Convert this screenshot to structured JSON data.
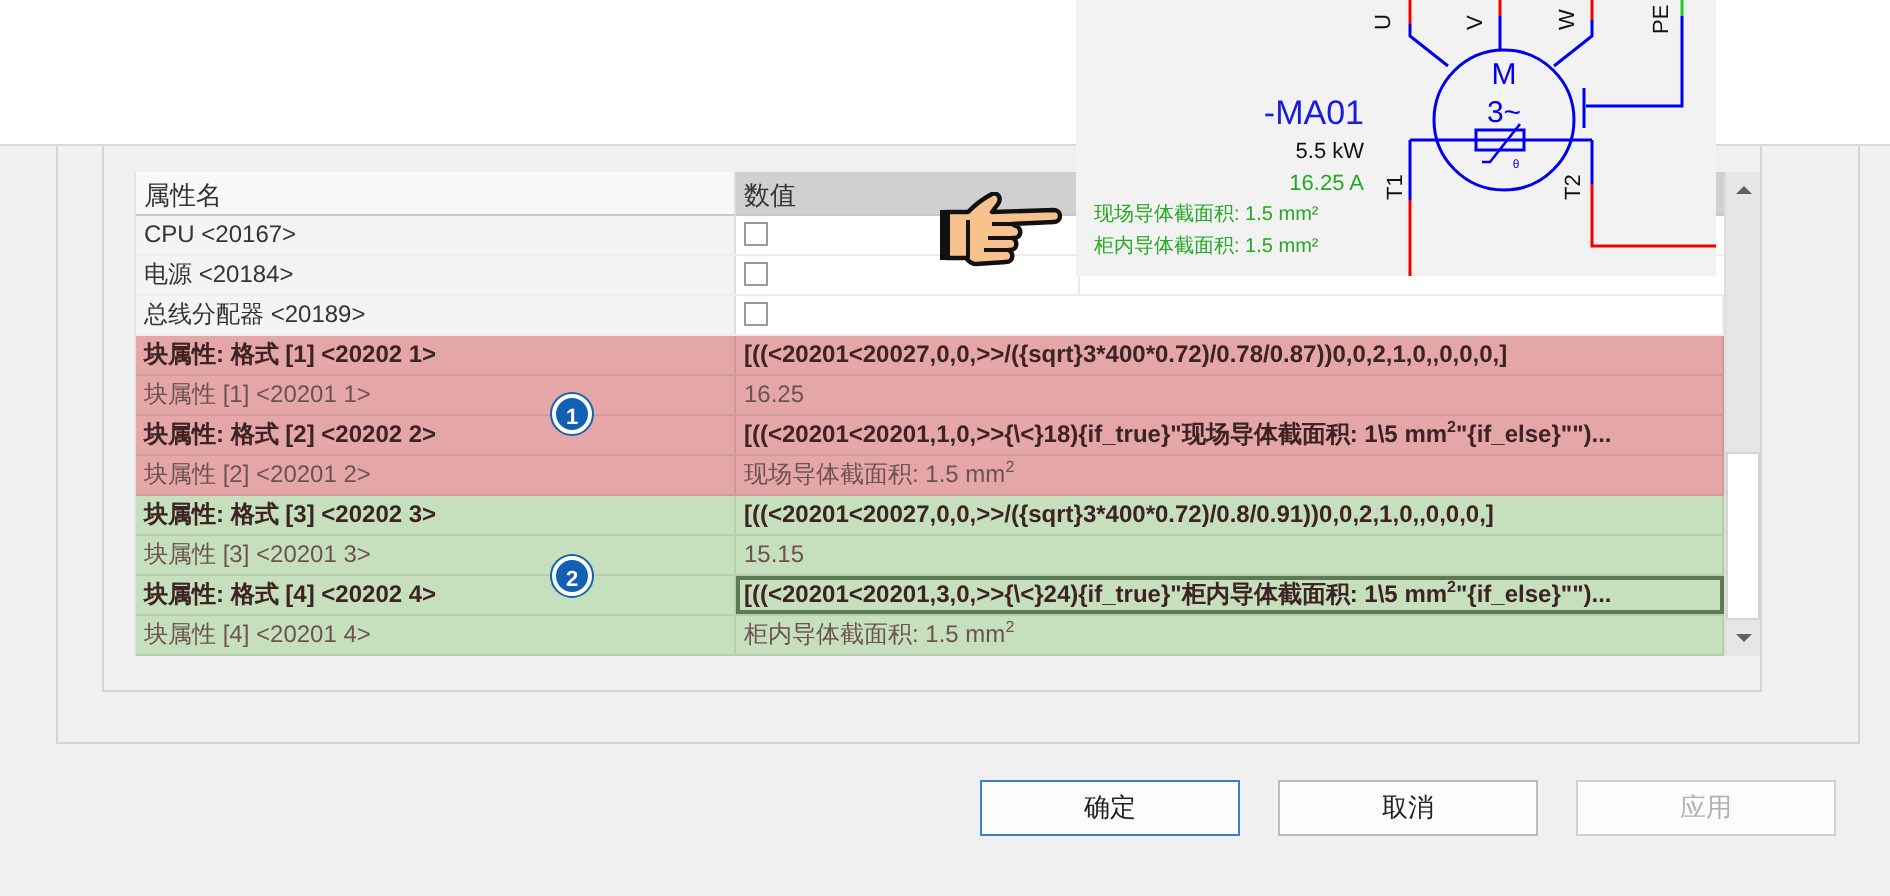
{
  "table": {
    "columns": [
      {
        "label": "属性名",
        "highlighted": false
      },
      {
        "label": "数值",
        "highlighted": true
      }
    ],
    "rows": [
      {
        "kind": "checkbox",
        "name": "CPU <20167>",
        "checked": false,
        "selected": false
      },
      {
        "kind": "checkbox",
        "name": "电源 <20184>",
        "checked": false,
        "selected": false
      },
      {
        "kind": "checkbox",
        "name": "总线分配器 <20189>",
        "checked": false,
        "selected": false
      },
      {
        "kind": "format",
        "color": "#e4a6a7",
        "name": "块属性: 格式 [1] <20202 1>",
        "value": "[((<20201<20027,0,0,>>/({sqrt}3*400*0.72)/0.78/0.87))0,0,2,1,0,,0,0,0,]",
        "selected": false
      },
      {
        "kind": "plain",
        "color": "#e4a6a7",
        "name": "块属性 [1] <20201 1>",
        "value": "16.25",
        "selected": false
      },
      {
        "kind": "format",
        "color": "#e4a6a7",
        "name": "块属性: 格式 [2] <20202 2>",
        "value": "[((<20201<20201,1,0,>>{\\<}18){if_true}\"**现场导体截面积**: 1\\5 mm$^{2}$\"{if_else}\"\")...",
        "selected": false
      },
      {
        "kind": "plain",
        "color": "#e4a6a7",
        "name": "块属性 [2] <20201 2>",
        "value": "现场导体截面积: 1.5 mm$^{2}$",
        "selected": false
      },
      {
        "kind": "format",
        "color": "#c6dfbd",
        "name": "块属性: 格式 [3] <20202 3>",
        "value": "[((<20201<20027,0,0,>>/({sqrt}3*400*0.72)/0.8/0.91))0,0,2,1,0,,0,0,0,]",
        "selected": false
      },
      {
        "kind": "plain",
        "color": "#c6dfbd",
        "name": "块属性 [3] <20201 3>",
        "value": "15.15",
        "selected": false
      },
      {
        "kind": "format",
        "color": "#c6dfbd",
        "name": "块属性: 格式 [4] <20202 4>",
        "value": "[((<20201<20201,3,0,>>{\\<}24){if_true}\"**柜内导体截面积**: 1\\5 mm$^{2}$\"{if_else}\"\")...",
        "selected": true
      },
      {
        "kind": "plain",
        "color": "#c6dfbd",
        "name": "块属性 [4] <20201 4>",
        "value": "柜内导体截面积: 1.5 mm$^{2}$",
        "selected": false
      }
    ]
  },
  "callouts": [
    {
      "label": "1"
    },
    {
      "label": "2"
    }
  ],
  "schematic": {
    "device": "-MA01",
    "power": "5.5 kW",
    "current": "16.25 A",
    "notes": [
      "现场导体截面积: 1.5 mm²",
      "柜内导体截面积: 1.5 mm²"
    ],
    "terminals": [
      "U",
      "V",
      "W",
      "PE",
      "T1",
      "T2"
    ],
    "symbol": [
      "M",
      "3~"
    ],
    "sensor_mark": "θ"
  },
  "buttons": [
    {
      "label": "确定",
      "default": true,
      "disabled": false
    },
    {
      "label": "取消",
      "default": false,
      "disabled": false
    },
    {
      "label": "应用",
      "default": false,
      "disabled": true
    }
  ]
}
